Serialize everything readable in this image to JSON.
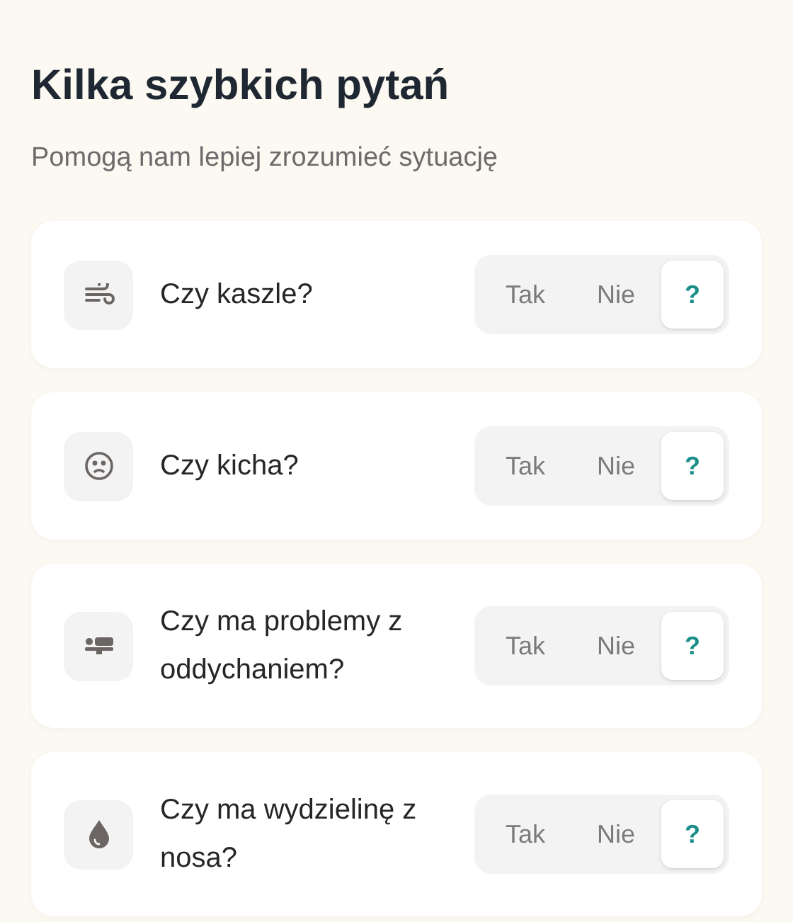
{
  "title": "Kilka szybkich pytań",
  "subtitle": "Pomogą nam lepiej zrozumieć sytuację",
  "questions": [
    {
      "text": "Czy kaszle?",
      "options": [
        {
          "label": "Tak",
          "selected": false
        },
        {
          "label": "Nie",
          "selected": false
        },
        {
          "label": "?",
          "selected": true
        }
      ]
    },
    {
      "text": "Czy kicha?",
      "options": [
        {
          "label": "Tak",
          "selected": false
        },
        {
          "label": "Nie",
          "selected": false
        },
        {
          "label": "?",
          "selected": true
        }
      ]
    },
    {
      "text": "Czy ma problemy z oddychaniem?",
      "options": [
        {
          "label": "Tak",
          "selected": false
        },
        {
          "label": "Nie",
          "selected": false
        },
        {
          "label": "?",
          "selected": true
        }
      ]
    },
    {
      "text": "Czy ma wydzielinę z nosa?",
      "options": [
        {
          "label": "Tak",
          "selected": false
        },
        {
          "label": "Nie",
          "selected": false
        },
        {
          "label": "?",
          "selected": true
        }
      ]
    }
  ]
}
